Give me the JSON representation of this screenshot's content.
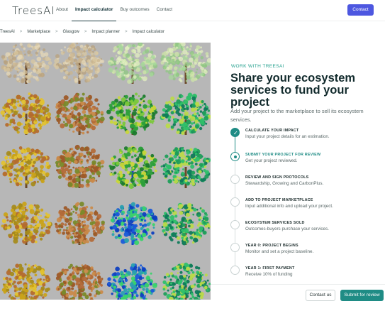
{
  "header": {
    "logo": "TreesAI",
    "nav": [
      "About",
      "Impact calculator",
      "Buy outcomes",
      "Contact"
    ],
    "active_nav": "Impact calculator",
    "contact_button": "Contact"
  },
  "breadcrumb": [
    "TreesAI",
    "Marketplace",
    "Glasgow",
    "Impact planner",
    "Impact calculator"
  ],
  "colors": {
    "accent_teal": "#1f8c85",
    "brand_blue": "#4d57e0",
    "eyebrow_teal": "#23a08e"
  },
  "hero": {
    "eyebrow": "WORK WITH TREESAI",
    "headline": "Share your ecosystem services to fund your project",
    "lead": "Add your project to the marketplace to sell its ecosystem services."
  },
  "steps": [
    {
      "title": "CALCULATE YOUR IMPACT",
      "desc": "Input your project details for an estimation.",
      "state": "done"
    },
    {
      "title": "SUBMIT YOUR PROJECT FOR REVIEW",
      "desc": "Get your project reviewed.",
      "state": "current"
    },
    {
      "title": "REVIEW AND SIGN PROTOCOLS",
      "desc": "Stewardship, Growing and CarbonPlus.",
      "state": "pending"
    },
    {
      "title": "ADD TO PROJECT MARKETPLACE",
      "desc": "Input additional info and upload your project.",
      "state": "pending"
    },
    {
      "title": "ECOSYSTEM SERVICES SOLD",
      "desc": "Outcomes-buyers purchase your services.",
      "state": "pending"
    },
    {
      "title": "YEAR 0: PROJECT BEGINS",
      "desc": "Monitor and set a project baseline.",
      "state": "pending"
    },
    {
      "title": "YEAR 1: FIRST PAYMENT",
      "desc": "Receive 10% of funding",
      "state": "pending"
    }
  ],
  "footer": {
    "secondary": "Contact us",
    "primary": "Submit for review"
  }
}
